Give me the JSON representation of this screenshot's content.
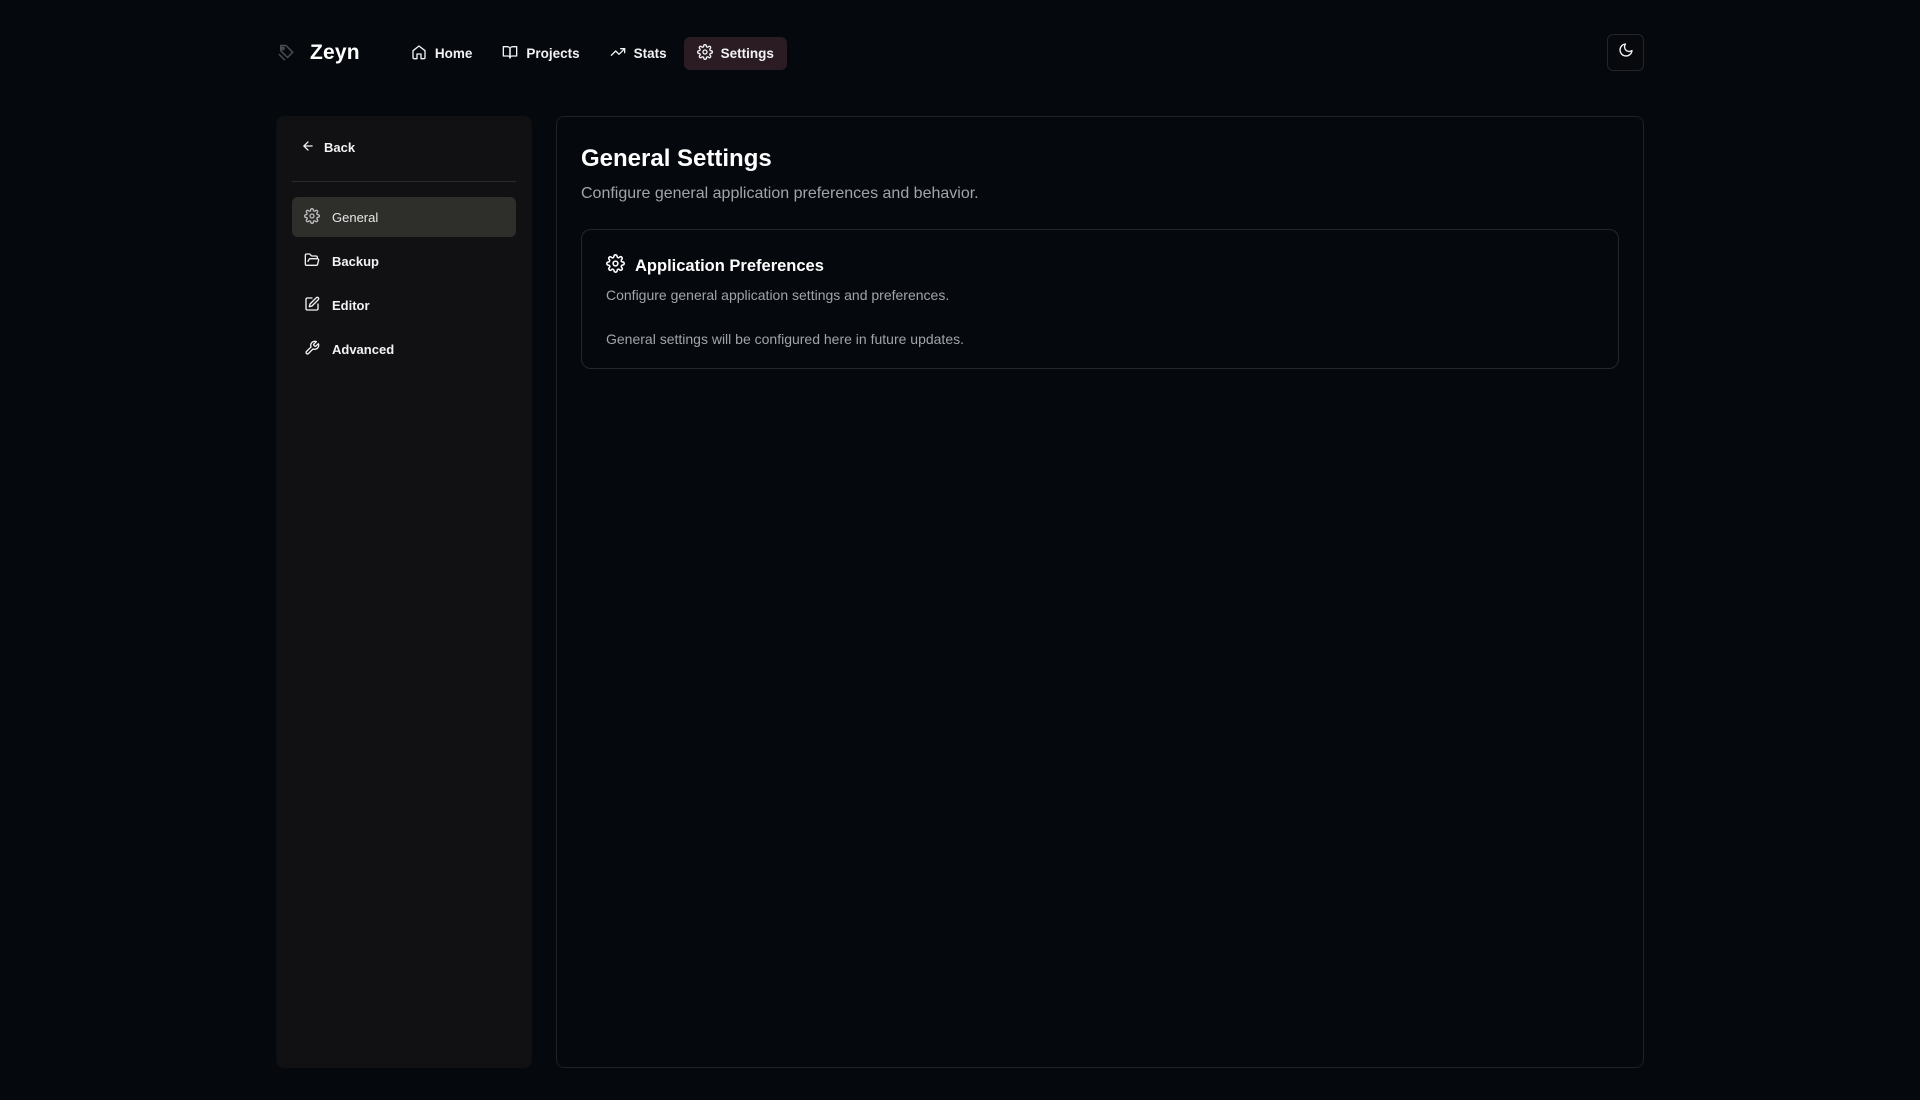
{
  "app": {
    "name": "Zeyn"
  },
  "nav": {
    "items": [
      {
        "label": "Home",
        "icon": "home-icon"
      },
      {
        "label": "Projects",
        "icon": "book-open-icon"
      },
      {
        "label": "Stats",
        "icon": "trending-up-icon"
      },
      {
        "label": "Settings",
        "icon": "gear-icon",
        "active": true
      }
    ],
    "theme_toggle_icon": "moon-icon"
  },
  "sidebar": {
    "back_label": "Back",
    "items": [
      {
        "label": "General",
        "icon": "gear-icon",
        "active": true
      },
      {
        "label": "Backup",
        "icon": "folder-open-icon"
      },
      {
        "label": "Editor",
        "icon": "edit-icon"
      },
      {
        "label": "Advanced",
        "icon": "wrench-icon"
      }
    ]
  },
  "main": {
    "title": "General Settings",
    "subtitle": "Configure general application preferences and behavior.",
    "card": {
      "title": "Application Preferences",
      "description": "Configure general application settings and preferences.",
      "note": "General settings will be configured here in future updates."
    }
  },
  "colors": {
    "background": "#05080c",
    "sidebar_bg": "#111113",
    "active_nav_bg": "#2a1c22",
    "active_side_bg": "#2e2f2b",
    "muted_text": "#a2a4aa"
  }
}
